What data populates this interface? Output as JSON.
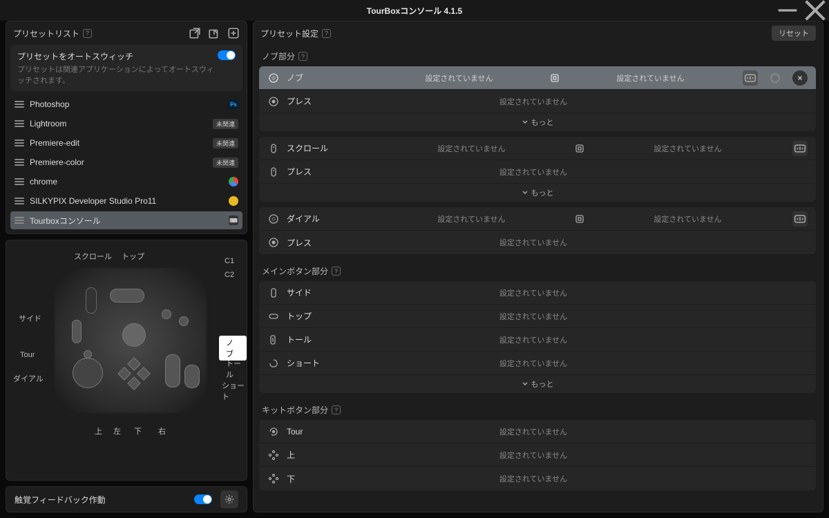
{
  "titlebar": {
    "title": "TourBoxコンソール 4.1.5"
  },
  "sidebar": {
    "header": "プリセットリスト",
    "autoswitch": {
      "title": "プリセットをオートスウィッチ",
      "desc": "プリセットは関連アプリケーションによってオートスウィッチされます。"
    },
    "presets": [
      {
        "name": "Photoshop",
        "badge": null,
        "icon": "ps"
      },
      {
        "name": "Lightroom",
        "badge": "未関連",
        "icon": null
      },
      {
        "name": "Premiere-edit",
        "badge": "未関連",
        "icon": null
      },
      {
        "name": "Premiere-color",
        "badge": "未関連",
        "icon": null
      },
      {
        "name": "chrome",
        "badge": null,
        "icon": "chrome"
      },
      {
        "name": "SILKYPIX Developer Studio Pro11",
        "badge": null,
        "icon": "silky"
      },
      {
        "name": "Tourboxコンソール",
        "badge": null,
        "icon": "tb",
        "selected": true
      }
    ]
  },
  "device": {
    "labels": {
      "scroll": "スクロール",
      "top": "トップ",
      "c1": "C1",
      "c2": "C2",
      "side": "サイド",
      "tour": "Tour",
      "dial": "ダイアル",
      "tall": "トール",
      "short": "ショート",
      "up": "上",
      "left": "左",
      "down": "下",
      "right": "右"
    },
    "callout": "ノブ"
  },
  "haptic": {
    "label": "触覚フィードバック作動"
  },
  "preset_settings": {
    "header": "プリセット設定",
    "reset": "リセット",
    "not_set": "設定されていません",
    "more": "もっと",
    "sections": {
      "knob": {
        "title": "ノブ部分",
        "rows": [
          {
            "label": "ノブ",
            "dual": true,
            "selected": true
          },
          {
            "label": "プレス"
          }
        ],
        "more": true
      },
      "scroll": {
        "rows": [
          {
            "label": "スクロール",
            "dual": true
          },
          {
            "label": "プレス"
          }
        ],
        "more": true
      },
      "dial": {
        "rows": [
          {
            "label": "ダイアル",
            "dual": true
          },
          {
            "label": "プレス"
          }
        ]
      },
      "main": {
        "title": "メインボタン部分",
        "rows": [
          {
            "label": "サイド"
          },
          {
            "label": "トップ"
          },
          {
            "label": "トール"
          },
          {
            "label": "ショート"
          }
        ],
        "more": true
      },
      "kit": {
        "title": "キットボタン部分",
        "rows": [
          {
            "label": "Tour"
          },
          {
            "label": "上"
          },
          {
            "label": "下"
          }
        ]
      }
    }
  }
}
